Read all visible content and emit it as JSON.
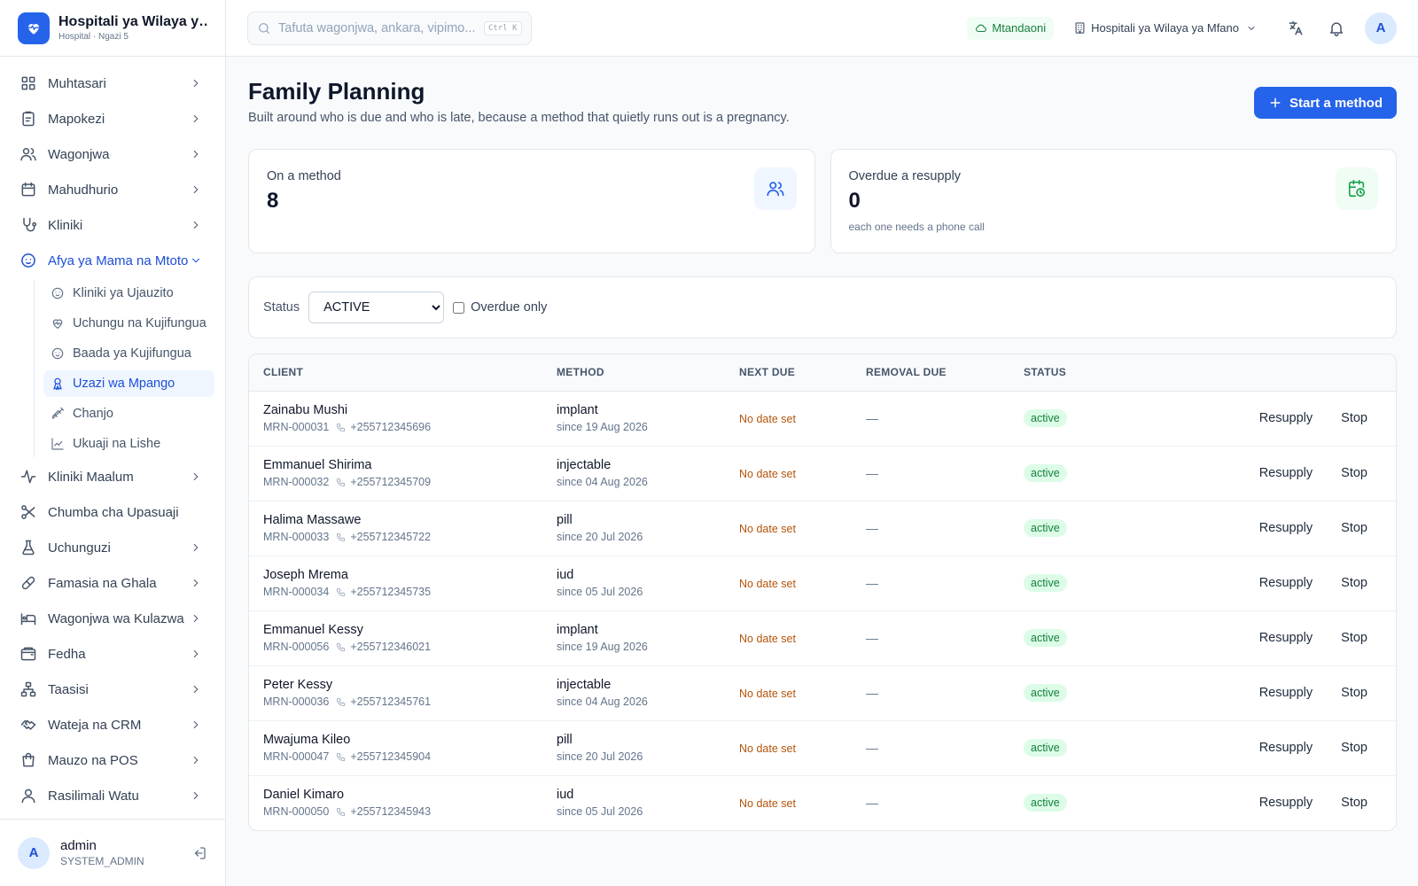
{
  "brand": {
    "name": "Hospitali ya Wilaya ya Mfano",
    "subtitle": "Hospital · Ngazi 5"
  },
  "sidebar": {
    "items": [
      {
        "label": "Muhtasari",
        "icon": "grid-icon"
      },
      {
        "label": "Mapokezi",
        "icon": "clipboard-icon"
      },
      {
        "label": "Wagonjwa",
        "icon": "users-icon"
      },
      {
        "label": "Mahudhurio",
        "icon": "calendar-icon"
      },
      {
        "label": "Kliniki",
        "icon": "stethoscope-icon"
      },
      {
        "label": "Afya ya Mama na Mtoto",
        "icon": "baby-icon",
        "expanded": true
      },
      {
        "label": "Kliniki Maalum",
        "icon": "activity-icon"
      },
      {
        "label": "Chumba cha Upasuaji",
        "icon": "scissors-icon"
      },
      {
        "label": "Uchunguzi",
        "icon": "flask-icon"
      },
      {
        "label": "Famasia na Ghala",
        "icon": "pill-icon"
      },
      {
        "label": "Wagonjwa wa Kulazwa",
        "icon": "bed-icon"
      },
      {
        "label": "Fedha",
        "icon": "wallet-icon"
      },
      {
        "label": "Taasisi",
        "icon": "network-icon"
      },
      {
        "label": "Wateja na CRM",
        "icon": "handshake-icon"
      },
      {
        "label": "Mauzo na POS",
        "icon": "shopping-bag-icon"
      },
      {
        "label": "Rasilimali Watu",
        "icon": "user-icon"
      }
    ],
    "sub_items": [
      {
        "label": "Kliniki ya Ujauzito",
        "icon": "baby-icon"
      },
      {
        "label": "Uchungu na Kujifungua",
        "icon": "heart-pulse-icon"
      },
      {
        "label": "Baada ya Kujifungua",
        "icon": "baby-icon"
      },
      {
        "label": "Uzazi wa Mpango",
        "icon": "ribbon-icon",
        "active": true
      },
      {
        "label": "Chanjo",
        "icon": "syringe-icon"
      },
      {
        "label": "Ukuaji na Lishe",
        "icon": "chart-line-icon"
      }
    ]
  },
  "user": {
    "initial": "A",
    "name": "admin",
    "role": "SYSTEM_ADMIN"
  },
  "topbar": {
    "search_placeholder": "Tafuta wagonjwa, ankara, vipimo...",
    "shortcut": "Ctrl K",
    "online_label": "Mtandaoni",
    "facility": "Hospitali ya Wilaya ya Mfano",
    "avatar_initial": "A"
  },
  "page": {
    "title": "Family Planning",
    "subtitle": "Built around who is due and who is late, because a method that quietly runs out is a pregnancy.",
    "start_button": "Start a method"
  },
  "stats": {
    "on_method": {
      "label": "On a method",
      "value": "8"
    },
    "overdue": {
      "label": "Overdue a resupply",
      "value": "0",
      "note": "each one needs a phone call"
    }
  },
  "filter": {
    "status_label": "Status",
    "status_value": "ACTIVE",
    "status_options": [
      "ACTIVE"
    ],
    "overdue_label": "Overdue only",
    "overdue_checked": false
  },
  "table": {
    "headers": {
      "client": "CLIENT",
      "method": "METHOD",
      "next_due": "NEXT DUE",
      "removal_due": "REMOVAL DUE",
      "status": "STATUS"
    },
    "actions": {
      "resupply": "Resupply",
      "stop": "Stop"
    },
    "rows": [
      {
        "name": "Zainabu Mushi",
        "mrn": "MRN-000031",
        "phone": "+255712345696",
        "method": "implant",
        "since": "since 19 Aug 2026",
        "next_due": "No date set",
        "removal_due": "—",
        "status": "active"
      },
      {
        "name": "Emmanuel Shirima",
        "mrn": "MRN-000032",
        "phone": "+255712345709",
        "method": "injectable",
        "since": "since 04 Aug 2026",
        "next_due": "No date set",
        "removal_due": "—",
        "status": "active"
      },
      {
        "name": "Halima Massawe",
        "mrn": "MRN-000033",
        "phone": "+255712345722",
        "method": "pill",
        "since": "since 20 Jul 2026",
        "next_due": "No date set",
        "removal_due": "—",
        "status": "active"
      },
      {
        "name": "Joseph Mrema",
        "mrn": "MRN-000034",
        "phone": "+255712345735",
        "method": "iud",
        "since": "since 05 Jul 2026",
        "next_due": "No date set",
        "removal_due": "—",
        "status": "active"
      },
      {
        "name": "Emmanuel Kessy",
        "mrn": "MRN-000056",
        "phone": "+255712346021",
        "method": "implant",
        "since": "since 19 Aug 2026",
        "next_due": "No date set",
        "removal_due": "—",
        "status": "active"
      },
      {
        "name": "Peter Kessy",
        "mrn": "MRN-000036",
        "phone": "+255712345761",
        "method": "injectable",
        "since": "since 04 Aug 2026",
        "next_due": "No date set",
        "removal_due": "—",
        "status": "active"
      },
      {
        "name": "Mwajuma Kileo",
        "mrn": "MRN-000047",
        "phone": "+255712345904",
        "method": "pill",
        "since": "since 20 Jul 2026",
        "next_due": "No date set",
        "removal_due": "—",
        "status": "active"
      },
      {
        "name": "Daniel Kimaro",
        "mrn": "MRN-000050",
        "phone": "+255712345943",
        "method": "iud",
        "since": "since 05 Jul 2026",
        "next_due": "No date set",
        "removal_due": "—",
        "status": "active"
      }
    ]
  },
  "colors": {
    "accent": "#2563eb",
    "active_badge_bg": "#dcfce7",
    "active_badge_text": "#15803d",
    "warning_text": "#b45309"
  }
}
